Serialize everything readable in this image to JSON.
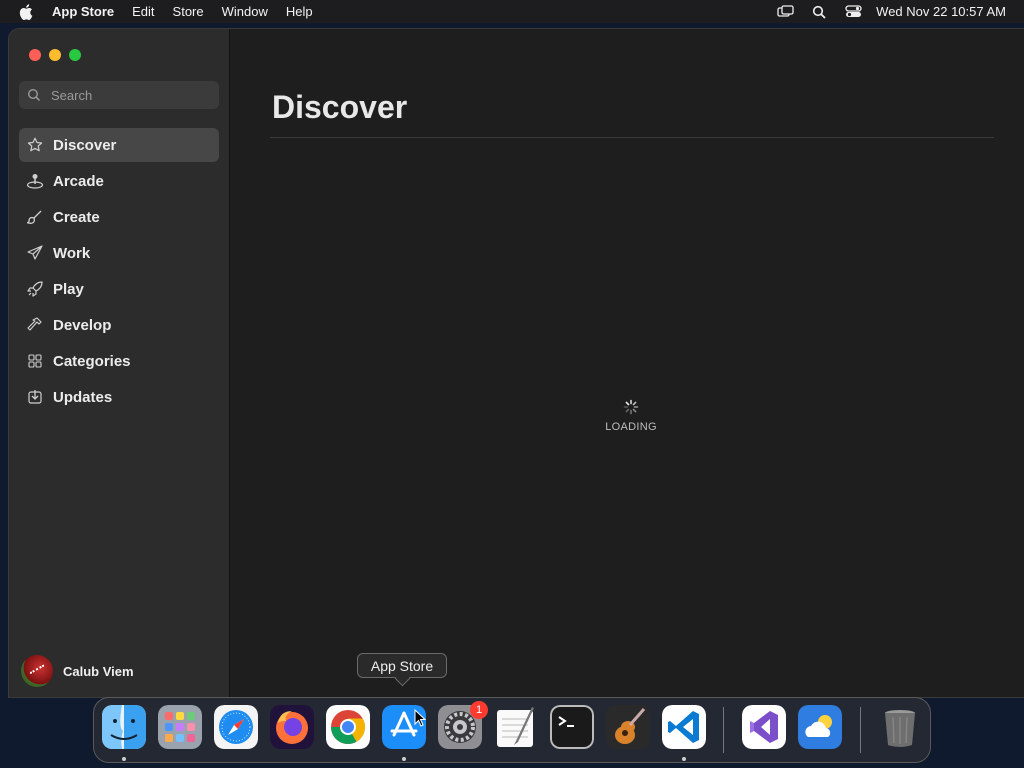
{
  "menubar": {
    "app_name": "App Store",
    "menus": [
      "Edit",
      "Store",
      "Window",
      "Help"
    ],
    "clock": "Wed Nov 22  10:57 AM",
    "status_icons": [
      "screen-mirroring-icon",
      "spotlight-search-icon",
      "control-center-icon"
    ]
  },
  "sidebar": {
    "search_placeholder": "Search",
    "items": [
      {
        "label": "Discover",
        "icon": "star-icon",
        "active": true
      },
      {
        "label": "Arcade",
        "icon": "joystick-icon"
      },
      {
        "label": "Create",
        "icon": "brush-icon"
      },
      {
        "label": "Work",
        "icon": "paper-plane-icon"
      },
      {
        "label": "Play",
        "icon": "rocket-icon"
      },
      {
        "label": "Develop",
        "icon": "hammer-icon"
      },
      {
        "label": "Categories",
        "icon": "grid-icon"
      },
      {
        "label": "Updates",
        "icon": "download-icon"
      }
    ],
    "user_name": "Calub Viem"
  },
  "main": {
    "title": "Discover",
    "loading_text": "LOADING"
  },
  "tooltip": {
    "text": "App Store"
  },
  "dock": {
    "apps": [
      {
        "name": "Finder",
        "icon": "finder-icon",
        "running": true
      },
      {
        "name": "Launchpad",
        "icon": "launchpad-icon"
      },
      {
        "name": "Safari",
        "icon": "safari-icon"
      },
      {
        "name": "Firefox",
        "icon": "firefox-icon"
      },
      {
        "name": "Chrome",
        "icon": "chrome-icon"
      },
      {
        "name": "App Store",
        "icon": "app-store-icon",
        "running": true
      },
      {
        "name": "System Settings",
        "icon": "system-settings-icon",
        "badge": "1"
      },
      {
        "name": "TextEdit",
        "icon": "textedit-icon"
      },
      {
        "name": "Terminal",
        "icon": "terminal-icon"
      },
      {
        "name": "GarageBand",
        "icon": "garageband-icon"
      },
      {
        "name": "Visual Studio Code",
        "icon": "vscode-icon",
        "running": true
      },
      {
        "name": "Visual Studio",
        "icon": "visual-studio-icon"
      },
      {
        "name": "Weather",
        "icon": "weather-icon"
      },
      {
        "name": "Trash",
        "icon": "trash-icon"
      }
    ]
  },
  "colors": {
    "close": "#ff5f57",
    "minimize": "#febc2e",
    "maximize": "#28c840",
    "sidebar_bg": "#2c2c2c",
    "content_bg": "#1e1e1e",
    "badge": "#ff3b30"
  }
}
